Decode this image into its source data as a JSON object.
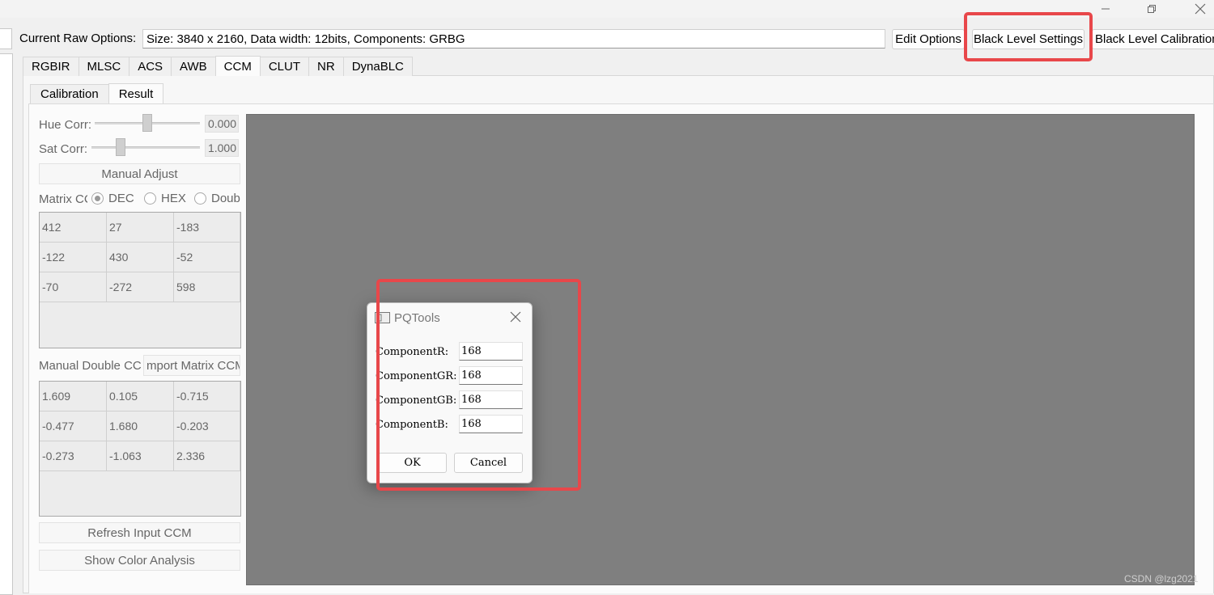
{
  "window": {
    "minimize_icon": "minimize-icon",
    "restore_icon": "restore-icon",
    "close_icon": "close-icon"
  },
  "raw_options": {
    "label": "Current Raw Options:",
    "value": "Size: 3840 x 2160, Data width: 12bits, Components: GRBG",
    "edit_button": "Edit Options",
    "black_level_settings_button": "Black Level Settings",
    "black_level_calibration_button": "Black Level Calibration"
  },
  "tabs": [
    "RGBIR",
    "MLSC",
    "ACS",
    "AWB",
    "CCM",
    "CLUT",
    "NR",
    "DynaBLC"
  ],
  "active_tab": "CCM",
  "subtabs": [
    "Calibration",
    "Result"
  ],
  "active_subtab": "Result",
  "ccm": {
    "hue_label": "Hue Corr:",
    "hue_value": "0.000",
    "sat_label": "Sat Corr:",
    "sat_value": "1.000",
    "manual_adjust": "Manual Adjust",
    "matrix_label": "Matrix CC",
    "radio_dec": "DEC",
    "radio_hex": "HEX",
    "radio_double": "Doub",
    "matrix": [
      [
        "412",
        "27",
        "-183"
      ],
      [
        "-122",
        "430",
        "-52"
      ],
      [
        "-70",
        "-272",
        "598"
      ]
    ],
    "manual_double_label": "Manual Double CC",
    "import_button": "mport Matrix CCM",
    "double_matrix": [
      [
        "1.609",
        "0.105",
        "-0.715"
      ],
      [
        "-0.477",
        "1.680",
        "-0.203"
      ],
      [
        "-0.273",
        "-1.063",
        "2.336"
      ]
    ],
    "refresh_button": "Refresh Input CCM",
    "show_color_button": "Show Color Analysis"
  },
  "dialog": {
    "title": "PQTools",
    "fields": [
      {
        "label": "ComponentR:",
        "value": "168"
      },
      {
        "label": "ComponentGR:",
        "value": "168"
      },
      {
        "label": "ComponentGB:",
        "value": "168"
      },
      {
        "label": "ComponentB:",
        "value": "168"
      }
    ],
    "ok": "OK",
    "cancel": "Cancel"
  },
  "watermark": "CSDN @lzg2021",
  "colors": {
    "highlight": "#e8474a",
    "preview": "#7f7f7f"
  }
}
